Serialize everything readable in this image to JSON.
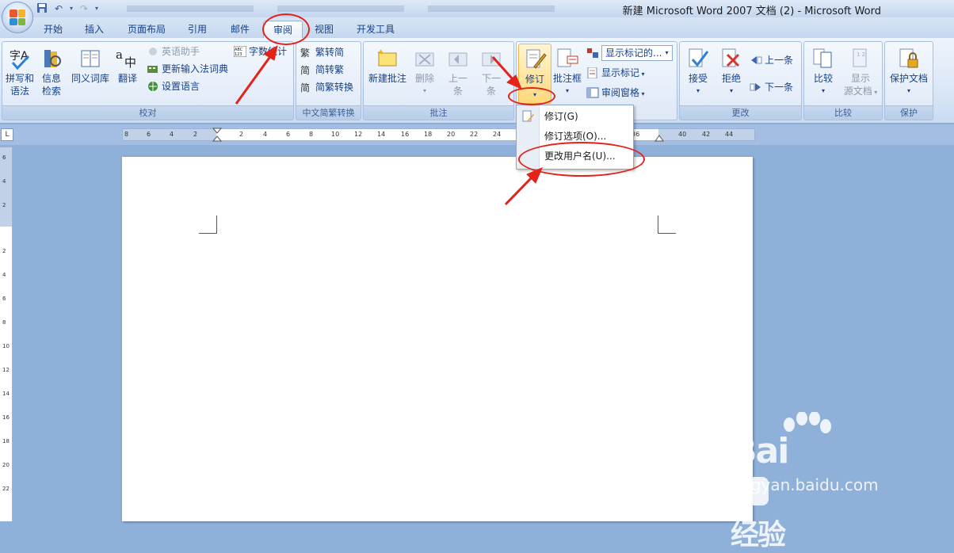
{
  "window": {
    "title": "新建 Microsoft Word 2007 文档 (2) - Microsoft Word"
  },
  "tabs": [
    "开始",
    "插入",
    "页面布局",
    "引用",
    "邮件",
    "审阅",
    "视图",
    "开发工具"
  ],
  "active_tab": "审阅",
  "groups": {
    "proofing": {
      "label": "校对",
      "spelling": "拼写和\n语法",
      "spelling_l1": "拼写和",
      "spelling_l2": "语法",
      "research_l1": "信息",
      "research_l2": "检索",
      "thesaurus": "同义词库",
      "translate": "翻译",
      "english_assistant": "英语助手",
      "update_ime": "更新输入法词典",
      "set_language": "设置语言",
      "word_count": "字数统计"
    },
    "chinese_conversion": {
      "label": "中文简繁转换",
      "to_simplified": "繁转简",
      "to_traditional": "简转繁",
      "conversion": "简繁转换"
    },
    "comments": {
      "label": "批注",
      "new_comment": "新建批注",
      "delete": "删除",
      "previous_l1": "上一",
      "previous_l2": "条",
      "next_l1": "下一",
      "next_l2": "条"
    },
    "tracking": {
      "label": "修订",
      "track_changes": "修订",
      "balloons": "批注框",
      "display_combo": "显示标记的...",
      "show_markup": "显示标记",
      "reviewing_pane": "审阅窗格"
    },
    "changes": {
      "label": "更改",
      "accept": "接受",
      "reject": "拒绝",
      "previous": "上一条",
      "next": "下一条"
    },
    "compare": {
      "label": "比较",
      "compare": "比较",
      "show_source_l1": "显示",
      "show_source_l2": "源文档"
    },
    "protect": {
      "label": "保护",
      "protect_document": "保护文档"
    }
  },
  "dropdown_menu": {
    "items": [
      "修订(G)",
      "修订选项(O)...",
      "更改用户名(U)..."
    ]
  },
  "ruler_ticks": [
    "8",
    "6",
    "4",
    "2",
    "2",
    "4",
    "6",
    "8",
    "10",
    "12",
    "14",
    "16",
    "18",
    "20",
    "22",
    "24",
    "36",
    "40",
    "42",
    "44"
  ],
  "vruler_ticks": [
    "6",
    "4",
    "2",
    "2",
    "4",
    "6",
    "8",
    "10",
    "12",
    "14",
    "16",
    "18",
    "20",
    "22"
  ],
  "watermark": {
    "brand": "Bai",
    "brand2": "经验",
    "url": "jingyan.baidu.com"
  },
  "colors": {
    "accent_red": "#e3231a",
    "ribbon_text": "#15428b"
  }
}
